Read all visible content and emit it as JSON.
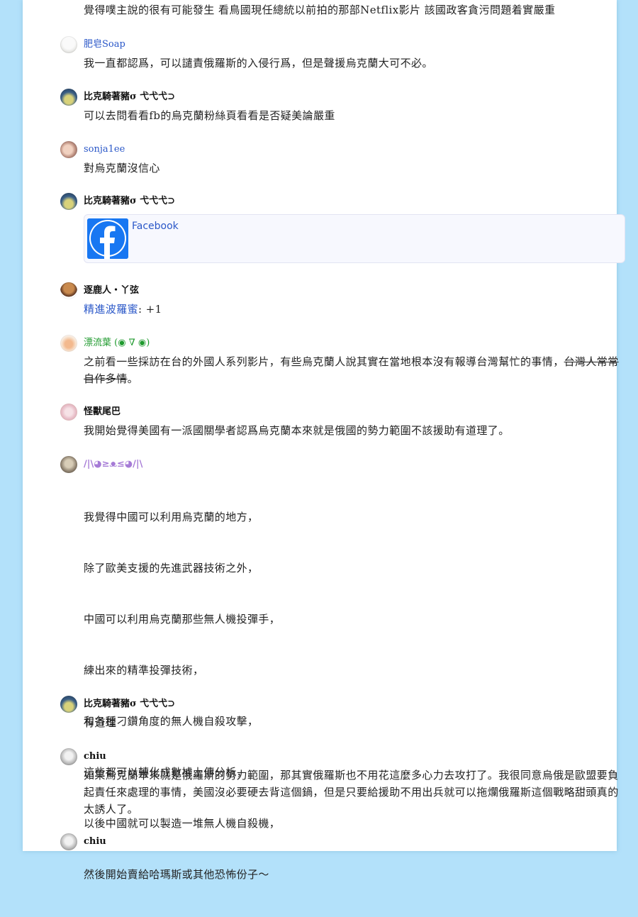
{
  "comments": [
    {
      "author": "",
      "body": "覺得噗主說的很有可能發生 看鳥國現任總統以前拍的那部Netflix影片 該國政客貪污問題着實嚴重"
    },
    {
      "author": "肥皂Soap",
      "body": "我一直都認爲，可以譴責俄羅斯的入侵行爲，但是聲援烏克蘭大可不必。"
    },
    {
      "author": "比克騎著豬σ 弋弋弋⊃",
      "body": "可以去問看看fb的烏克蘭粉絲頁看看是否疑美論嚴重"
    },
    {
      "author": "sonja1ee",
      "body": "對烏克蘭沒信心"
    },
    {
      "author": "比克騎著豬σ 弋弋弋⊃",
      "card": {
        "title": "Facebook",
        "icon": "facebook-logo-icon"
      }
    },
    {
      "author": "逐鹿人・丫弦",
      "link": "精進波羅蜜",
      "suffix": ": +1"
    },
    {
      "author": "漂流葉 (◉ ∇ ◉)",
      "body": "之前看一些採訪在台的外國人系列影片，有些烏克蘭人說其實在當地根本沒有報導台灣幫忙的事情，",
      "strike": "台灣人常常自作多情",
      "tail": "。"
    },
    {
      "author": "怪獸尾巴",
      "body": "我開始覺得美國有一派國關學者認爲烏克蘭本來就是俄國的勢力範圍不該援助有道理了。"
    },
    {
      "author": "/|\\◕≥ᴥ≤◕/|\\",
      "lines": [
        "我覺得中國可以利用烏克蘭的地方，",
        "除了歐美支援的先進武器技術之外，",
        "中國可以利用烏克蘭那些無人機投彈手，",
        "練出來的精準投彈技術，",
        "和各種刁鑽角度的無人機自殺攻擊，",
        "這些都可以轉化成數據上傳分析，",
        "以後中國就可以製造一堆無人機自殺機，",
        "然後開始賣給哈瑪斯或其他恐怖份子～"
      ]
    },
    {
      "author": "比克騎著豬σ 弋弋弋⊃",
      "body": "有道理"
    },
    {
      "author": "chiu",
      "body": "如果烏克蘭本來就是俄羅斯的勢力範圍，那其實俄羅斯也不用花這麼多心力去攻打了。我很同意烏俄是歐盟要負起責任來處理的事情，美國沒必要硬去背這個鍋，但是只要給援助不用出兵就可以拖爛俄羅斯這個戰略甜頭真的太誘人了。"
    },
    {
      "author": "chiu"
    }
  ],
  "colors": {
    "background": "#b3e1fa",
    "link": "#2a57c8",
    "green_author": "#1f9a2e",
    "purple_author": "#a67bd6",
    "facebook_blue": "#1877f2"
  }
}
